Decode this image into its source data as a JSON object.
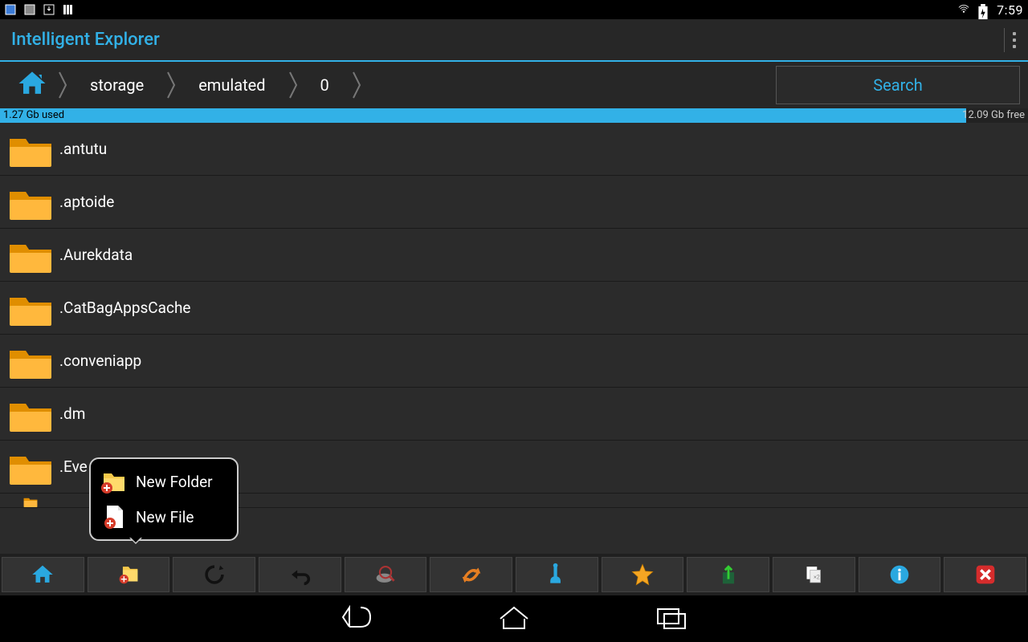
{
  "statusbar": {
    "time": "7:59"
  },
  "titlebar": {
    "title": "Intelligent Explorer"
  },
  "breadcrumbs": {
    "b0": "storage",
    "b1": "emulated",
    "b2": "0"
  },
  "search": {
    "label": "Search"
  },
  "storage": {
    "used": "1.27 Gb used",
    "free": "12.09 Gb free"
  },
  "files": {
    "f0": ".antutu",
    "f1": ".aptoide",
    "f2": ".Aurekdata",
    "f3": ".CatBagAppsCache",
    "f4": ".conveniapp",
    "f5": ".dm",
    "f6": ".Eve"
  },
  "popup": {
    "item0": "New Folder",
    "item1": "New File"
  }
}
